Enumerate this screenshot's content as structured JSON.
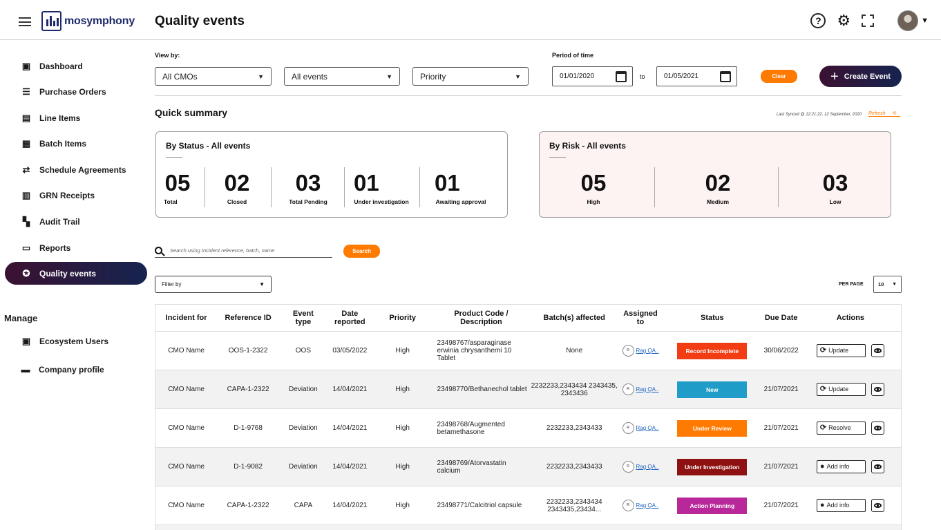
{
  "app": {
    "logo_text": "mosymphony",
    "page_title": "Quality events"
  },
  "topbar_icons": [
    "help-icon",
    "settings-icon",
    "export-icon",
    "avatar"
  ],
  "sidebar": {
    "items": [
      {
        "label": "Dashboard",
        "icon": "dashboard-icon"
      },
      {
        "label": "Purchase Orders",
        "icon": "purchase-orders-icon"
      },
      {
        "label": "Line Items",
        "icon": "line-items-icon"
      },
      {
        "label": "Batch Items",
        "icon": "batch-items-icon"
      },
      {
        "label": "Schedule Agreements",
        "icon": "schedule-icon"
      },
      {
        "label": "GRN Receipts",
        "icon": "receipt-icon"
      },
      {
        "label": "Audit Trail",
        "icon": "audit-icon"
      },
      {
        "label": "Reports",
        "icon": "reports-icon"
      },
      {
        "label": "Quality events",
        "icon": "quality-icon",
        "active": true
      }
    ],
    "manage_label": "Manage",
    "manage_items": [
      {
        "label": "Ecosystem Users",
        "icon": "users-icon"
      },
      {
        "label": "Company profile",
        "icon": "briefcase-icon"
      }
    ]
  },
  "filters": {
    "view_by_label": "View by:",
    "cmo": "All CMOs",
    "events": "All events",
    "priority": "Priority",
    "period_label": "Period of time",
    "date_from": "01/01/2020",
    "to_label": "to",
    "date_to": "01/05/2021",
    "clear": "Clear",
    "create": "Create Event"
  },
  "summary": {
    "title": "Quick summary",
    "last_synced": "Last Synced @ 12:21:22, 12 September, 2020",
    "refresh": "Refresh",
    "status_card": {
      "title": "By Status - All events",
      "stats": [
        {
          "num": "05",
          "label": "Total"
        },
        {
          "num": "02",
          "label": "Closed"
        },
        {
          "num": "03",
          "label": "Total Pending"
        },
        {
          "num": "01",
          "label": "Under investigation"
        },
        {
          "num": "01",
          "label": "Awaiting approval"
        }
      ]
    },
    "risk_card": {
      "title": "By Risk - All events",
      "stats": [
        {
          "num": "05",
          "label": "High"
        },
        {
          "num": "02",
          "label": "Medium"
        },
        {
          "num": "03",
          "label": "Low"
        }
      ]
    }
  },
  "search": {
    "placeholder": "Search using Incident reference, batch, name",
    "button": "Search"
  },
  "list_controls": {
    "filter_by": "Filter by",
    "per_page_label": "PER PAGE",
    "per_page": "10"
  },
  "table": {
    "headers": [
      "Incident for",
      "Reference ID",
      "Event type",
      "Date reported",
      "Priority",
      "Product Code / Description",
      "Batch(s) affected",
      "Assigned to",
      "Status",
      "Due Date",
      "Actions"
    ],
    "rows": [
      {
        "incident": "CMO Name",
        "ref": "OOS-1-2322",
        "type": "OOS",
        "date": "03/05/2022",
        "priority": "High",
        "product": "23498767/asparaginase erwinia chrysanthemi 10 Tablet",
        "batch": "None",
        "assignee_initial": "R",
        "assignee": "Rag QA..",
        "status": "Record Incomplete",
        "status_color": "#f23d14",
        "due": "30/06/2022",
        "action": "Update",
        "action_icon": "refresh-icon"
      },
      {
        "incident": "CMO Name",
        "ref": "CAPA-1-2322",
        "type": "Deviation",
        "date": "14/04/2021",
        "priority": "High",
        "product": "23498770/Bethanechol tablet",
        "batch": "2232233,2343434 2343435, 2343436",
        "assignee_initial": "R",
        "assignee": "Rag QA..",
        "status": "New",
        "status_color": "#1f9cc7",
        "due": "21/07/2021",
        "action": "Update",
        "action_icon": "refresh-icon"
      },
      {
        "incident": "CMO Name",
        "ref": "D-1-9768",
        "type": "Deviation",
        "date": "14/04/2021",
        "priority": "High",
        "product": "23498768/Augmented betamethasone",
        "batch": "2232233,2343433",
        "assignee_initial": "R",
        "assignee": "Rag QA..",
        "status": "Under Review",
        "status_color": "#ff7a00",
        "due": "21/07/2021",
        "action": "Resolve",
        "action_icon": "refresh-icon"
      },
      {
        "incident": "CMO Name",
        "ref": "D-1-9082",
        "type": "Deviation",
        "date": "14/04/2021",
        "priority": "High",
        "product": "23498769/Atorvastatin calcium",
        "batch": "2232233,2343433",
        "assignee_initial": "R",
        "assignee": "Rag QA..",
        "status": "Under Investigation",
        "status_color": "#8e1212",
        "due": "21/07/2021",
        "action": "Add info",
        "action_icon": "info-icon"
      },
      {
        "incident": "CMO Name",
        "ref": "CAPA-1-2322",
        "type": "CAPA",
        "date": "14/04/2021",
        "priority": "High",
        "product": "23498771/Calcitriol capsule",
        "batch": "2232233,2343434 2343435,23434...",
        "assignee_initial": "R",
        "assignee": "Rag QA..",
        "status": "Action Planning",
        "status_color": "#b8289a",
        "due": "21/07/2021",
        "action": "Add info",
        "action_icon": "info-icon"
      }
    ]
  }
}
